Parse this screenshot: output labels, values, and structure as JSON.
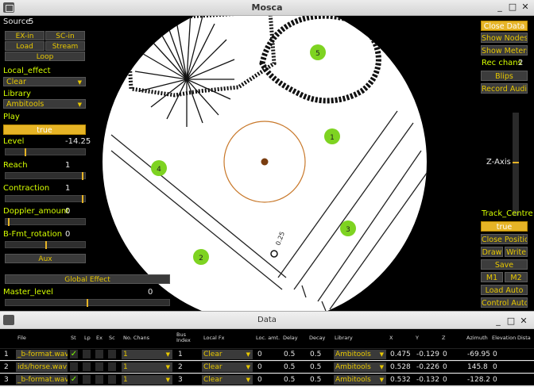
{
  "mosca_window": {
    "title": "Mosca",
    "controls": [
      "_",
      "□",
      "✕"
    ]
  },
  "left_panel": {
    "source_label": "Source",
    "source_value": "5",
    "ex_in": "EX-in",
    "sc_in": "SC-in",
    "load": "Load",
    "stream": "Stream",
    "loop": "Loop",
    "local_effect_label": "Local_effect",
    "local_effect_value": "Clear",
    "library_label": "Library",
    "library_value": "Ambitools",
    "play_label": "Play",
    "play_value": "true",
    "level_label": "Level",
    "level_value": "-14.25",
    "reach_label": "Reach",
    "reach_value": "1",
    "contraction_label": "Contraction",
    "contraction_value": "1",
    "doppler_label": "Doppler_amount",
    "doppler_value": "0",
    "bfmt_label": "B-Fmt_rotation",
    "bfmt_value": "0",
    "aux": "Aux",
    "global_effect": "Global Effect",
    "master_level_label": "Master_level",
    "master_level_value": "0"
  },
  "right_panel": {
    "close_data": "Close Data",
    "show_nodes": "Show Nodes",
    "show_meters": "Show Meters",
    "rec_chans_label": "Rec chans",
    "rec_chans_value": "2",
    "blips": "Blips",
    "record_audio": "Record Audio",
    "z_axis": "Z-Axis",
    "track_centre": "Track_Centre",
    "track_value": "true",
    "close_position": "Close Position",
    "draw": "Draw",
    "write": "Write",
    "save": "Save",
    "m1": "M1",
    "m2": "M2",
    "load_auto": "Load Auto",
    "control_auto": "Control Auto"
  },
  "scene": {
    "sources": [
      "1",
      "2",
      "3",
      "4",
      "5"
    ],
    "map_label": "0.25",
    "colors": {
      "source_fill": "#7ed321",
      "ring": "#c8782a",
      "center": "#7a3d10",
      "accent": "#e6b426"
    }
  },
  "data_window": {
    "title": "Data",
    "columns": [
      "File",
      "St",
      "Lp",
      "Ex",
      "Sc",
      "No. Chans",
      "Bus Index",
      "Local Fx",
      "Loc. amt.",
      "Delay",
      "Decay",
      "Library",
      "X",
      "Y",
      "Z",
      "Azimuth",
      "Elevation",
      "Dista"
    ],
    "rows": [
      {
        "n": "1",
        "file": "_b-format.wav\"",
        "st": "✓",
        "chans": "1",
        "bus": "1",
        "fx": "Clear",
        "loc": "0",
        "delay": "0.5",
        "decay": "0.5",
        "lib": "Ambitools",
        "x": "0.475",
        "y": "-0.129",
        "z": "0",
        "az": "-69.95",
        "el": "0"
      },
      {
        "n": "2",
        "file": "ids/horse.wav\"",
        "st": "",
        "chans": "1",
        "bus": "2",
        "fx": "Clear",
        "loc": "0",
        "delay": "0.5",
        "decay": "0.5",
        "lib": "Ambitools",
        "x": "0.528",
        "y": "-0.226",
        "z": "0",
        "az": "145.8",
        "el": "0"
      },
      {
        "n": "3",
        "file": "_b-format.wav\"",
        "st": "✓",
        "chans": "1",
        "bus": "3",
        "fx": "Clear",
        "loc": "0",
        "delay": "0.5",
        "decay": "0.5",
        "lib": "Ambitools",
        "x": "0.532",
        "y": "-0.132",
        "z": "0",
        "az": "-128.2",
        "el": "0"
      }
    ]
  }
}
